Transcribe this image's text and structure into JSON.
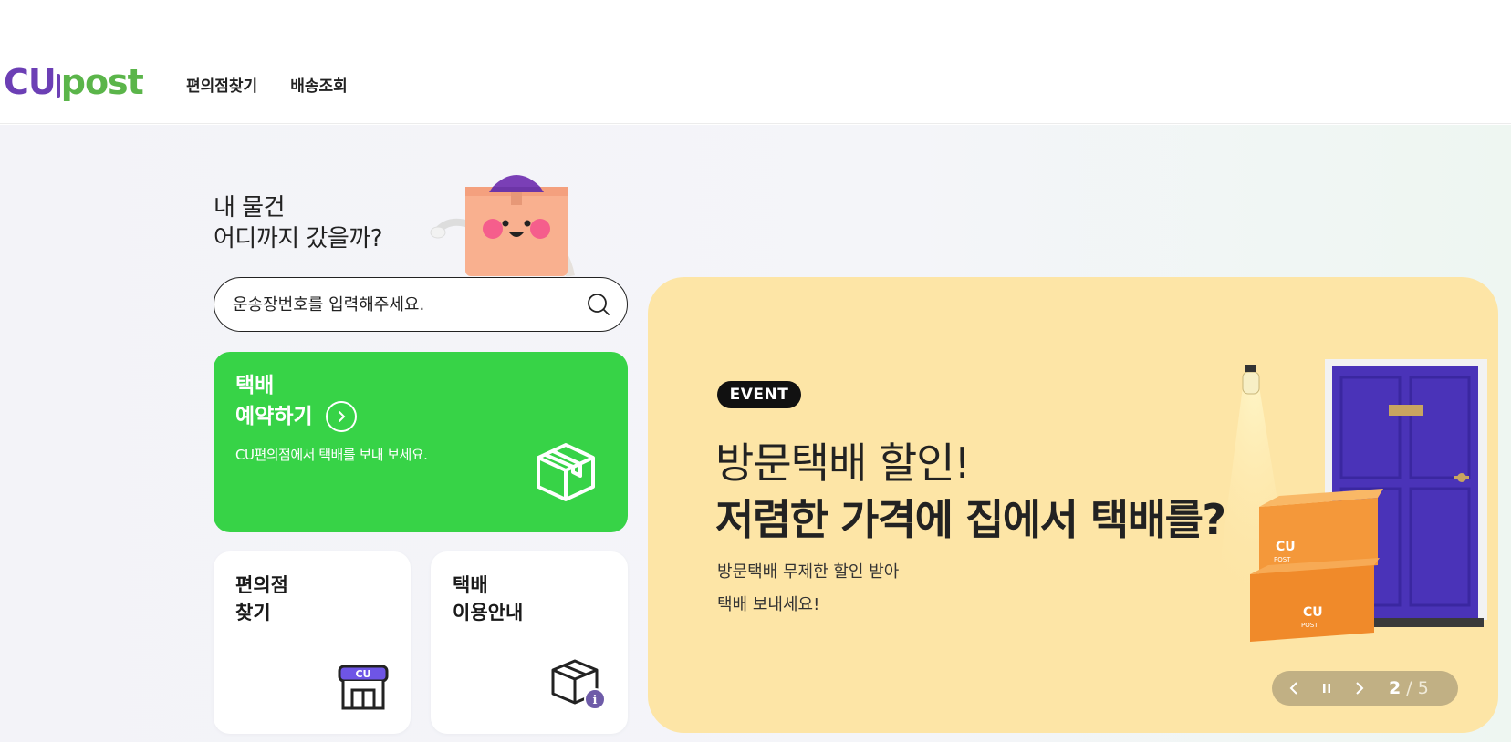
{
  "header": {
    "logo": {
      "left": "CU",
      "right": "post"
    },
    "nav": [
      "편의점찾기",
      "배송조회"
    ]
  },
  "hero": {
    "title_line1": "내 물건",
    "title_line2": "어디까지 갔을까?",
    "search": {
      "placeholder": "운송장번호를 입력해주세요.",
      "value": ""
    },
    "reserve_card": {
      "title_line1": "택배",
      "title_line2": "예약하기",
      "description": "CU편의점에서 택배를 보내 보세요.",
      "color": "#37d347"
    },
    "store_card": {
      "line1": "편의점",
      "line2": "찾기",
      "icon_label": "CU"
    },
    "guide_card": {
      "line1": "택배",
      "line2": "이용안내"
    }
  },
  "banner": {
    "badge": "EVENT",
    "title_line1": "방문택배 할인!",
    "title_line2": "저렴한 가격에 집에서 택배를?",
    "desc_line1": "방문택배 무제한 할인 받아",
    "desc_line2": "택배 보내세요!",
    "box_label": "CU",
    "box_sublabel": "POST",
    "slider": {
      "current": "2",
      "separator": "/",
      "total": "5"
    },
    "color": "#fde5a6"
  }
}
